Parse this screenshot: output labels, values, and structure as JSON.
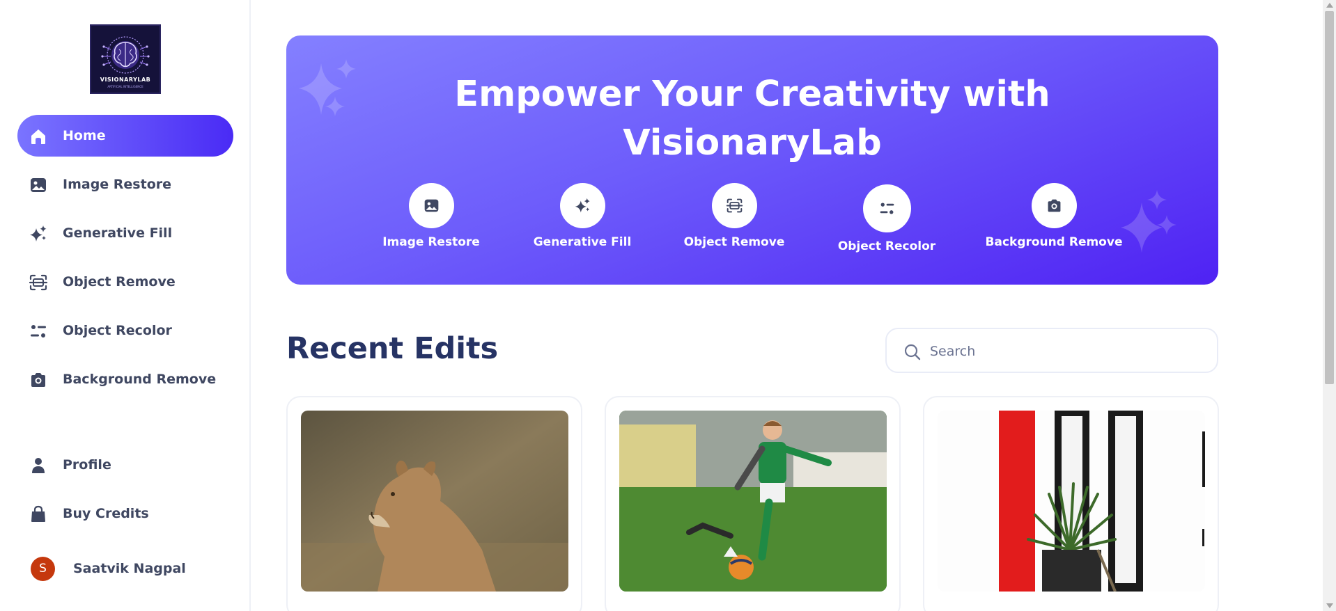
{
  "brand": {
    "logo_text": "VISIONARYLAB",
    "logo_subtext": "ARTIFICIAL INTELLIGENCE"
  },
  "sidebar": {
    "items": [
      {
        "label": "Home",
        "icon": "home-icon",
        "active": true
      },
      {
        "label": "Image Restore",
        "icon": "image-icon"
      },
      {
        "label": "Generative Fill",
        "icon": "sparkles-icon"
      },
      {
        "label": "Object Remove",
        "icon": "scan-icon"
      },
      {
        "label": "Object Recolor",
        "icon": "filter-icon"
      },
      {
        "label": "Background Remove",
        "icon": "camera-icon"
      }
    ],
    "bottom_items": [
      {
        "label": "Profile",
        "icon": "user-icon"
      },
      {
        "label": "Buy Credits",
        "icon": "bag-icon"
      }
    ],
    "user": {
      "initial": "S",
      "name": "Saatvik Nagpal"
    }
  },
  "hero": {
    "title_line1": "Empower Your Creativity with",
    "title_line2": "VisionaryLab",
    "tools": [
      {
        "label": "Image Restore",
        "icon": "image-icon"
      },
      {
        "label": "Generative Fill",
        "icon": "sparkles-icon"
      },
      {
        "label": "Object Remove",
        "icon": "scan-icon"
      },
      {
        "label": "Object Recolor",
        "icon": "filter-icon"
      },
      {
        "label": "Background Remove",
        "icon": "camera-icon"
      }
    ]
  },
  "recent": {
    "title": "Recent Edits",
    "search_placeholder": "Search",
    "cards": [
      {
        "image": "lioness-photo"
      },
      {
        "image": "boy-soccer-photo"
      },
      {
        "image": "plant-window-photo"
      }
    ]
  },
  "colors": {
    "accent_start": "#7a74ff",
    "accent_end": "#4a2bf5",
    "heading": "#263364",
    "text": "#3f4761",
    "avatar": "#c5380d"
  }
}
